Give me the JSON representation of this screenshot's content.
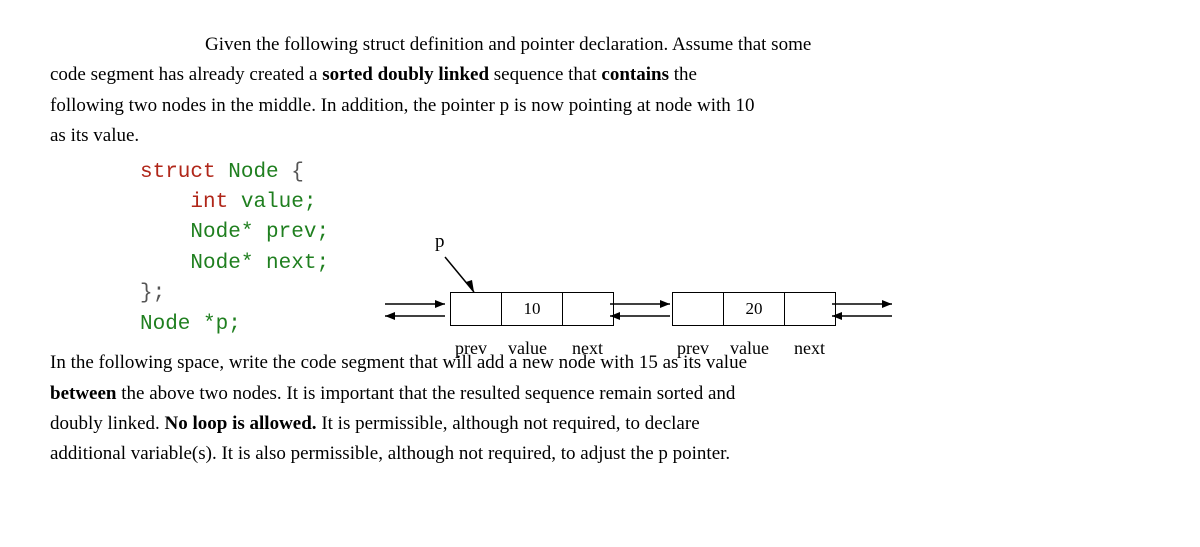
{
  "paragraph1_line1": "Given the following struct definition and pointer declaration. Assume that some",
  "paragraph1_line2": "code segment has already created a sorted doubly linked sequence that contains the",
  "paragraph1_line3": "following two nodes in the middle. In addition, the pointer p is now pointing at node with 10",
  "paragraph1_line4": "as its value.",
  "code": {
    "l1_struct": "struct",
    "l1_node": "Node",
    "l1_brace": "{",
    "l2_int": "int",
    "l2_value": "value;",
    "l3_node": "Node*",
    "l3_prev": "prev;",
    "l4_node": "Node*",
    "l4_next": "next;",
    "l5_close": "};",
    "l6_node": "Node",
    "l6_ptr": "*p;"
  },
  "diagram": {
    "p_label": "p",
    "node1_value": "10",
    "node2_value": "20",
    "label_prev": "prev",
    "label_value": "value",
    "label_next": "next"
  },
  "paragraph2_line1a": "In the following space, write the code segment that will add a new node with 15 as its value",
  "paragraph2_line2_a": "between",
  "paragraph2_line2_b": " the above two nodes. It is important that the resulted sequence remain sorted and",
  "paragraph2_line3_a": "doubly linked. ",
  "paragraph2_line3_b": "No loop is allowed.",
  "paragraph2_line3_c": " It is permissible, although not required, to declare",
  "paragraph2_line4": "additional variable(s). It is also permissible, although not required, to adjust the p pointer."
}
